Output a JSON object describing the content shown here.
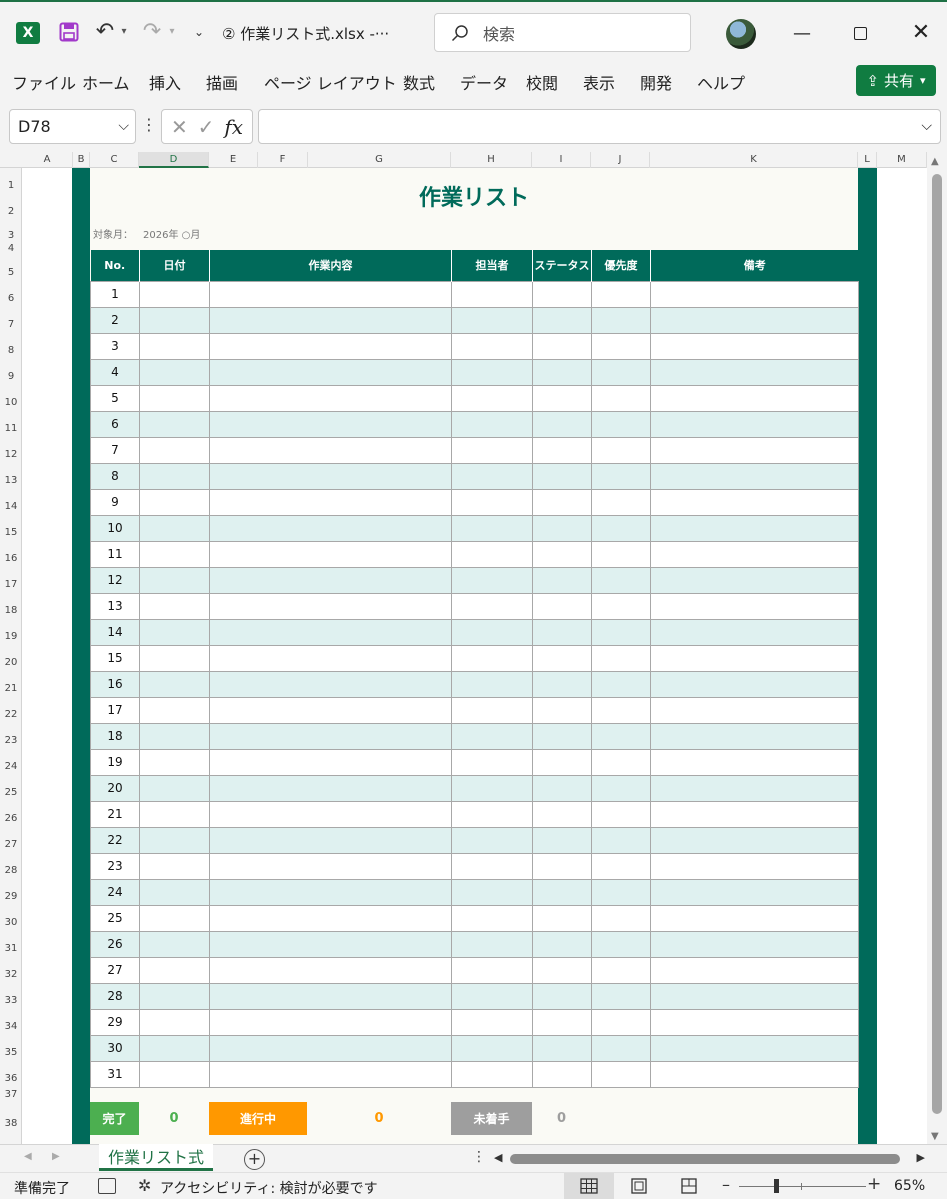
{
  "window": {
    "title": "② 作業リスト式.xlsx  -···",
    "search_placeholder": "検索",
    "logo_letter": "X"
  },
  "ribbon": {
    "tabs": [
      "ファイル",
      "ホーム",
      "挿入",
      "描画",
      "ページ レイアウト",
      "数式",
      "データ",
      "校閲",
      "表示",
      "開発",
      "ヘルプ"
    ],
    "share_label": "共有"
  },
  "formula_bar": {
    "name_box": "D78",
    "formula": ""
  },
  "grid": {
    "columns": [
      "A",
      "B",
      "C",
      "D",
      "E",
      "F",
      "G",
      "H",
      "I",
      "J",
      "K",
      "L",
      "M"
    ],
    "selected_column": "D"
  },
  "sheet": {
    "title": "作業リスト",
    "month_label": "対象月：",
    "month_value": "2026年 ○月",
    "headers": [
      "No.",
      "日付",
      "作業内容",
      "担当者",
      "ステータス",
      "優先度",
      "備考"
    ],
    "rows": [
      "1",
      "2",
      "3",
      "4",
      "5",
      "6",
      "7",
      "8",
      "9",
      "10",
      "11",
      "12",
      "13",
      "14",
      "15",
      "16",
      "17",
      "18",
      "19",
      "20",
      "21",
      "22",
      "23",
      "24",
      "25",
      "26",
      "27",
      "28",
      "29",
      "30",
      "31"
    ],
    "summary": {
      "done_label": "完了",
      "done_value": "0",
      "done_color": "#4caf50",
      "progress_label": "進行中",
      "progress_value": "0",
      "progress_color": "#ff9800",
      "todo_label": "未着手",
      "todo_value": "0",
      "todo_color": "#9e9e9e"
    },
    "frame_color": "#006a5a",
    "stripe_color": "#dff1f0"
  },
  "sheet_tabs": {
    "active": "作業リスト式"
  },
  "status_bar": {
    "ready": "準備完了",
    "accessibility": "アクセシビリティ: 検討が必要です",
    "zoom": "65%"
  }
}
